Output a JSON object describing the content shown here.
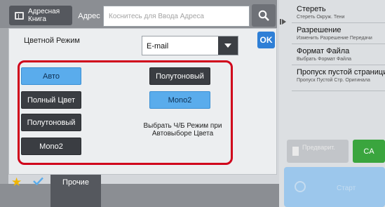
{
  "header": {
    "address_book_label": "Адресная Книга",
    "address_label": "Адрес",
    "address_placeholder": "Коснитесь для Ввода Адреса"
  },
  "right_menu": [
    {
      "title": "Стереть",
      "subtitle": "Стереть Окруж. Тени"
    },
    {
      "title": "Разрешение",
      "subtitle": "Изменить Разрешение Передачи"
    },
    {
      "title": "Формат Файла",
      "subtitle": "Выбрать Формат Файла"
    },
    {
      "title": "Пропуск пустой страници",
      "subtitle": "Пропуск Пустой Стр. Оригинала"
    }
  ],
  "actions": {
    "preview_label": "Предварит.",
    "ca_label": "CA",
    "start_label": "Старт"
  },
  "bottom": {
    "other_label": "Прочие"
  },
  "dialog": {
    "ok_label": "OK",
    "color_mode_label": "Цветной Режим",
    "mode_select_value": "E-mail",
    "color_buttons": {
      "auto": "Авто",
      "full_color": "Полный Цвет",
      "halftone": "Полутоновый",
      "mono2": "Mono2"
    },
    "bw_auto_buttons": {
      "halftone": "Полутоновый",
      "mono2": "Mono2"
    },
    "bw_auto_text": "Выбрать Ч/Б Режим при Автовыборе Цвета",
    "selected": [
      "auto",
      "mono2-bw"
    ]
  },
  "colors": {
    "accent_blue": "#5aacec",
    "ok_blue": "#2f7fd6",
    "highlight_red": "#d0011b",
    "ca_green": "#3aa53e"
  }
}
